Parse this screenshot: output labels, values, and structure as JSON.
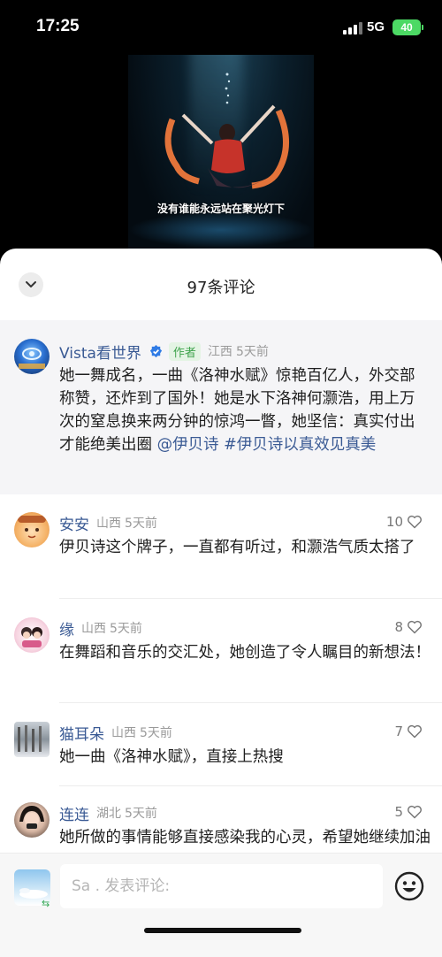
{
  "status_bar": {
    "time": "17:25",
    "network": "5G",
    "battery": "40"
  },
  "video": {
    "caption": "没有谁能永远站在聚光灯下"
  },
  "comments_sheet": {
    "title": "97条评论",
    "author_comment": {
      "name": "Vista看世界",
      "badge": "作者",
      "location": "江西",
      "time": "5天前",
      "text": "她一舞成名，一曲《洛神水赋》惊艳百亿人，外交部称赞，还炸到了国外！她是水下洛神何灏浩，用上万次的窒息换来两分钟的惊鸿一瞥，她坚信：真实付出才能绝美出圈 ",
      "tag1": "@伊贝诗",
      "tag2": "#伊贝诗以真效见真美"
    },
    "comments": [
      {
        "name": "安安",
        "location": "山西",
        "time": "5天前",
        "likes": "10",
        "text": "伊贝诗这个牌子，一直都有听过，和灏浩气质太搭了"
      },
      {
        "name": "缘",
        "location": "山西",
        "time": "5天前",
        "likes": "8",
        "text": "在舞蹈和音乐的交汇处，她创造了令人瞩目的新想法！"
      },
      {
        "name": "猫耳朵",
        "location": "山西",
        "time": "5天前",
        "likes": "7",
        "text": "她一曲《洛神水赋》，直接上热搜"
      },
      {
        "name": "连连",
        "location": "湖北",
        "time": "5天前",
        "likes": "5",
        "text": "她所做的事情能够直接感染我的心灵，希望她继续加油"
      }
    ]
  },
  "input": {
    "placeholder": "Sa . 发表评论:"
  },
  "colors": {
    "link": "#3a5a94",
    "author_badge": "#3fa34d",
    "battery": "#4cd964"
  }
}
